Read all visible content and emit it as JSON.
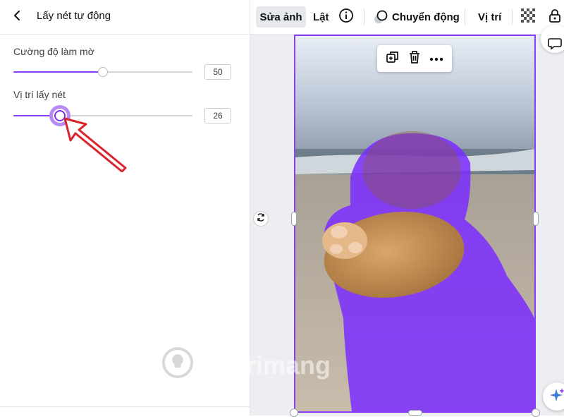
{
  "panel": {
    "title": "Lấy nét tự động",
    "sliders": [
      {
        "label": "Cường độ làm mờ",
        "value": "50",
        "fraction": 0.5
      },
      {
        "label": "Vị trí lấy nét",
        "value": "26",
        "fraction": 0.26
      }
    ]
  },
  "toolbar": {
    "edit_photo": "Sửa ảnh",
    "flip": "Lật",
    "motion": "Chuyển động",
    "position": "Vị trí"
  },
  "watermark": "uantrimang",
  "colors": {
    "accent": "#8b3dff",
    "selection_overlay": "#7a2bff",
    "annotation_arrow": "#d8242a"
  },
  "icons": {
    "back": "chevron-left-icon",
    "info": "info-circle-icon",
    "motion": "motion-circles-icon",
    "transparency": "checkerboard-icon",
    "lock": "lock-icon",
    "duplicate": "duplicate-icon",
    "delete": "trash-icon",
    "more": "ellipsis-icon",
    "rotate": "rotate-icon",
    "comment": "comment-icon",
    "magic": "sparkle-icon"
  }
}
